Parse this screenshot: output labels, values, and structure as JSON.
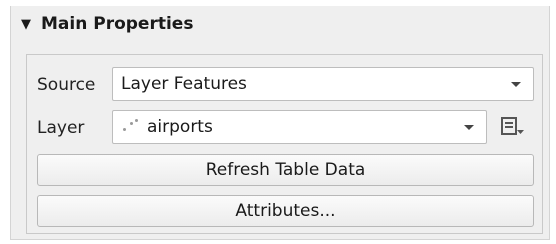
{
  "group": {
    "title": "Main Properties",
    "collapse_icon": "caret-down-icon"
  },
  "source": {
    "label": "Source",
    "value": "Layer Features"
  },
  "layer": {
    "label": "Layer",
    "value": "airports",
    "layer_icon": "point-layer-icon",
    "expression_icon": "expression-list-icon"
  },
  "buttons": {
    "refresh": "Refresh Table Data",
    "attributes": "Attributes..."
  }
}
